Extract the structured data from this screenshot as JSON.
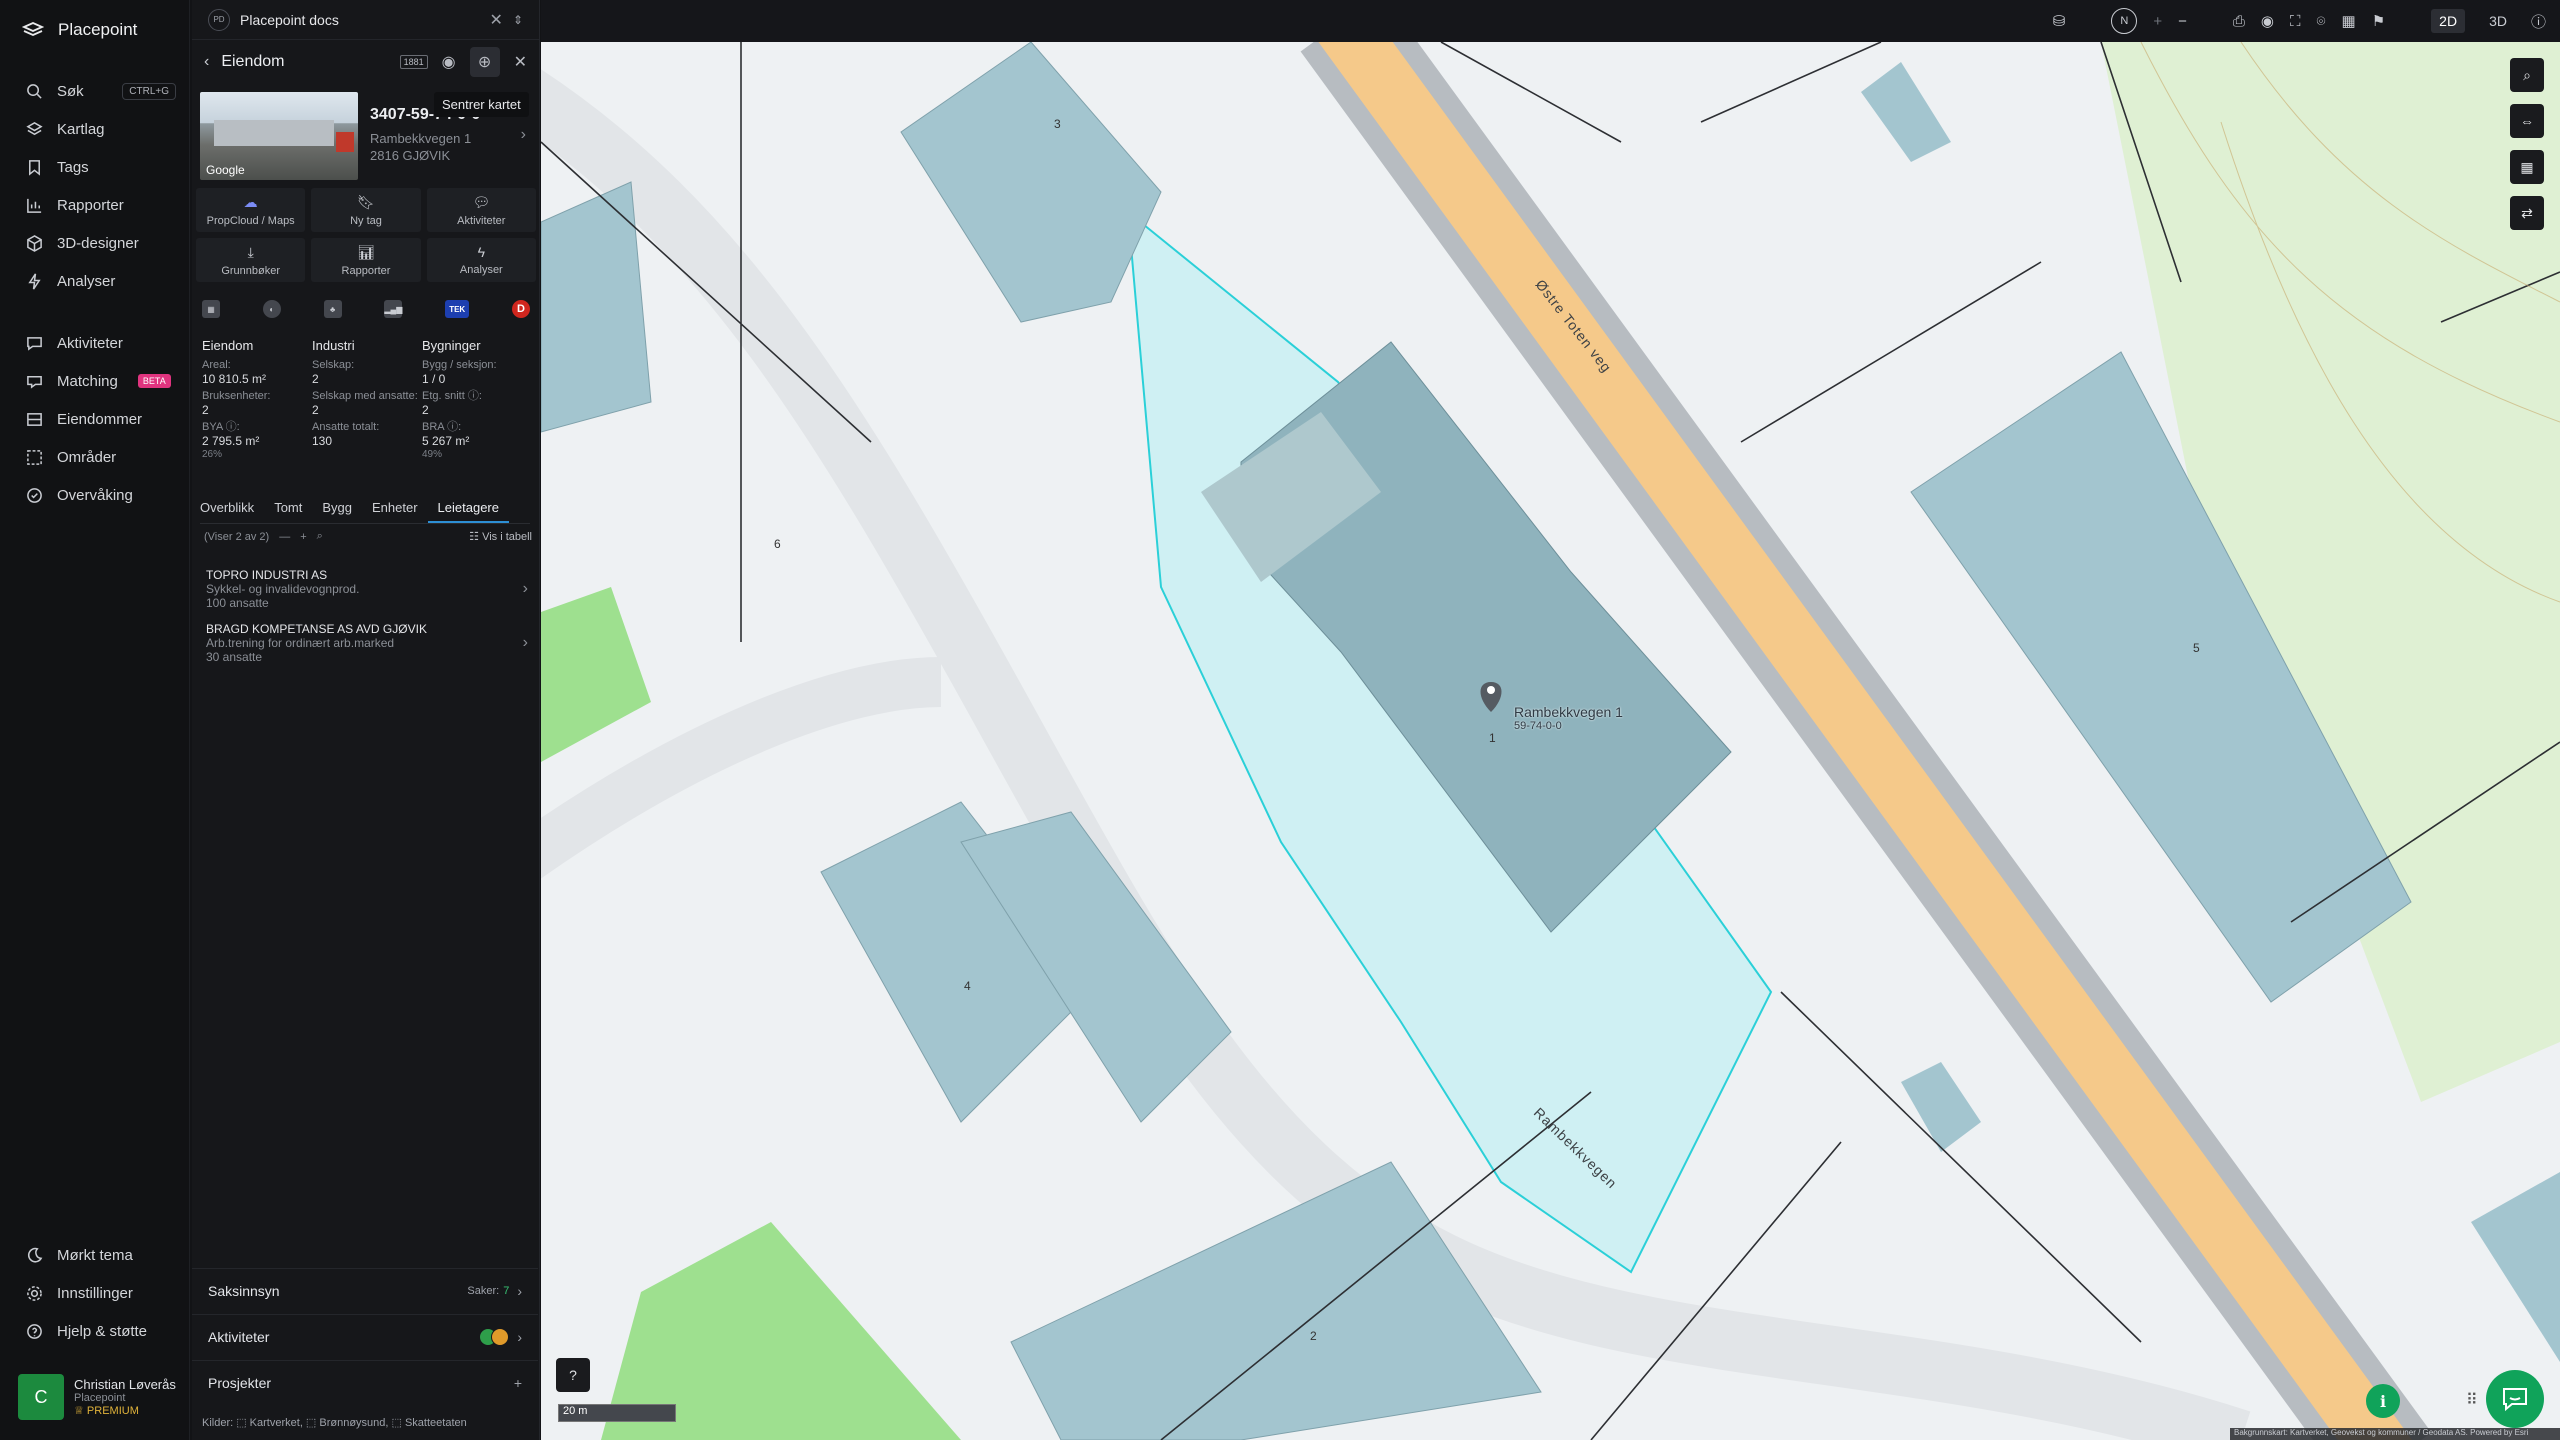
{
  "app": {
    "name": "Placepoint"
  },
  "nav": {
    "items": [
      {
        "label": "Søk",
        "shortcut": "CTRL+G",
        "icon": "search-icon"
      },
      {
        "label": "Kartlag",
        "icon": "layers-icon"
      },
      {
        "label": "Tags",
        "icon": "bookmark-icon"
      },
      {
        "label": "Rapporter",
        "icon": "chart-icon"
      },
      {
        "label": "3D-designer",
        "icon": "cube-icon"
      },
      {
        "label": "Analyser",
        "icon": "bolt-icon"
      }
    ],
    "items2": [
      {
        "label": "Aktiviteter",
        "icon": "activity-icon"
      },
      {
        "label": "Matching",
        "badge": "BETA",
        "icon": "match-icon"
      },
      {
        "label": "Eiendommer",
        "icon": "property-icon"
      },
      {
        "label": "Områder",
        "icon": "area-icon"
      },
      {
        "label": "Overvåking",
        "icon": "monitor-icon"
      }
    ],
    "bottom": [
      {
        "label": "Mørkt tema",
        "icon": "moon-icon"
      },
      {
        "label": "Innstillinger",
        "icon": "gear-icon"
      },
      {
        "label": "Hjelp & støtte",
        "icon": "help-icon"
      }
    ],
    "user": {
      "initial": "C",
      "name": "Christian Løverås",
      "org": "Placepoint",
      "plan": "PREMIUM"
    }
  },
  "panel": {
    "workspace_badge": "PD",
    "workspace": "Placepoint docs",
    "title": "Eiendom",
    "tooltip": "Sentrer kartet",
    "property": {
      "id": "3407-59-74-0-0",
      "address1": "Rambekkvegen 1",
      "address2": "2816 GJØVIK",
      "thumb_label": "Google"
    },
    "actions": [
      {
        "label": "PropCloud / Maps",
        "icon": "cloud-icon"
      },
      {
        "label": "Ny tag",
        "icon": "bookmark-icon"
      },
      {
        "label": "Aktiviteter",
        "icon": "activity-icon"
      },
      {
        "label": "Grunnbøker",
        "icon": "download-icon"
      },
      {
        "label": "Rapporter",
        "icon": "chart-icon"
      },
      {
        "label": "Analyser",
        "icon": "bolt-icon"
      }
    ],
    "sources": {
      "tek": "TEK",
      "d": "D"
    },
    "facts": {
      "eiendom": {
        "title": "Eiendom",
        "areal_label": "Areal:",
        "areal": "10 810.5 m²",
        "bruks_label": "Bruksenheter:",
        "bruks": "2",
        "bya_label": "BYA ⓘ:",
        "bya": "2 795.5 m²",
        "bya_pct": "26%"
      },
      "industri": {
        "title": "Industri",
        "selskap_label": "Selskap:",
        "selskap": "2",
        "ansatte_label": "Selskap med ansatte:",
        "ansatte": "2",
        "totalt_label": "Ansatte totalt:",
        "totalt": "130"
      },
      "bygninger": {
        "title": "Bygninger",
        "bygg_label": "Bygg / seksjon:",
        "bygg": "1 / 0",
        "etg_label": "Etg. snitt ⓘ:",
        "etg": "2",
        "bra_label": "BRA ⓘ:",
        "bra": "5 267 m²",
        "bra_pct": "49%"
      }
    },
    "tabs": [
      "Overblikk",
      "Tomt",
      "Bygg",
      "Enheter",
      "Leietagere"
    ],
    "list": {
      "count": "(Viser 2 av 2)",
      "table_link": "Vis i tabell"
    },
    "tenants": [
      {
        "name": "TOPRO INDUSTRI AS",
        "desc": "Sykkel- og invalidevognprod.",
        "emp": "100 ansatte"
      },
      {
        "name": "BRAGD KOMPETANSE AS AVD GJØVIK",
        "desc": "Arb.trening for ordinært arb.marked",
        "emp": "30 ansatte"
      }
    ],
    "sections": {
      "saksinnsyn": {
        "label": "Saksinnsyn",
        "cases_label": "Saker:",
        "cases": "7"
      },
      "aktiviteter": {
        "label": "Aktiviteter"
      },
      "prosjekter": {
        "label": "Prosjekter",
        "add": "+"
      }
    },
    "kilder": "Kilder:  ⬚ Kartverket,  ⬚ Brønnøysund,  ⬚ Skatteetaten"
  },
  "map": {
    "streets": [
      "Østre Toten veg",
      "Rambekkvegen"
    ],
    "pin_label": "Rambekkvegen 1",
    "pin_sub": "59-74-0-0",
    "scale": "20 m",
    "house_numbers": [
      "3",
      "6",
      "1",
      "5",
      "4",
      "2"
    ],
    "attribution": "Bakgrunnskart: Kartverket, Geovekst og kommuner / Geodata AS. Powered by Esri",
    "modes": [
      "2D",
      "3D"
    ],
    "north": "N",
    "colors": {
      "parcel": "#2bd0d8",
      "road": "#f5c98a",
      "building": "#a3c5cf",
      "grass": "#9ee08f"
    }
  }
}
